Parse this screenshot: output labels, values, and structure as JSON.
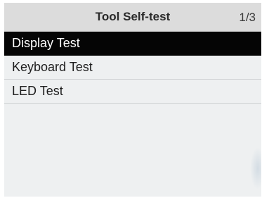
{
  "header": {
    "title": "Tool Self-test",
    "page_indicator": "1/3"
  },
  "menu": {
    "items": [
      {
        "label": "Display Test",
        "selected": true
      },
      {
        "label": "Keyboard Test",
        "selected": false
      },
      {
        "label": "LED Test",
        "selected": false
      }
    ]
  },
  "colors": {
    "header_bg": "#dcdcdc",
    "screen_bg": "#eef0f1",
    "selected_bg": "#050505",
    "selected_text": "#ffffff"
  }
}
